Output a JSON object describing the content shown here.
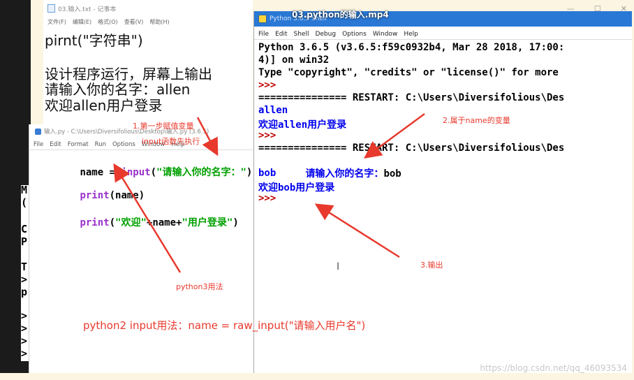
{
  "video_title": "03.python的输入.mp4",
  "notepad": {
    "title": "03.输入.txt - 记事本",
    "menu": [
      "文件(F)",
      "编辑(E)",
      "格式(O)",
      "查看(V)",
      "帮助(H)"
    ],
    "lines": [
      "pirnt(\"字符串\")",
      "",
      "设计程序运行，屏幕上输出",
      "请输入你的名字：allen",
      "欢迎allen用户登录"
    ]
  },
  "editor": {
    "title": "输入.py - C:\\Users\\Diversifolious\\Desktop\\输入.py (3.6.5)",
    "menu": [
      "File",
      "Edit",
      "Format",
      "Run",
      "Options",
      "Window",
      "Help"
    ],
    "code": {
      "l1_a": "name = ",
      "l1_b": "input",
      "l1_c": "(",
      "l1_d": "\"请输入你的名字：\"",
      "l1_e": ")",
      "l2_a": "print",
      "l2_b": "(name)",
      "l3_a": "print",
      "l3_b": "(",
      "l3_c": "\"欢迎\"",
      "l3_d": "+name+",
      "l3_e": "\"用户登录\"",
      "l3_f": ")"
    }
  },
  "shell": {
    "title": "Python 3.6.5 Shell",
    "menu": [
      "File",
      "Edit",
      "Shell",
      "Debug",
      "Options",
      "Window",
      "Help"
    ],
    "lines": {
      "l1": "Python 3.6.5 (v3.6.5:f59c0932b4, Mar 28 2018, 17:00:",
      "l2": "4)] on win32",
      "l3": "Type \"copyright\", \"credits\" or \"license()\" for more",
      "l4": ">>>",
      "l5": "=============== RESTART: C:\\Users\\Diversifolious\\Des",
      "l6": "allen",
      "l7": "欢迎allen用户登录",
      "l8": ">>>",
      "l9": "=============== RESTART: C:\\Users\\Diversifolious\\Des",
      "l10a": "请输入你的名字：",
      "l10b": "bob",
      "l11": "bob",
      "l12": "欢迎bob用户登录",
      "l13": ">>>"
    }
  },
  "annotations": {
    "a1": "1.第一步赋值变量",
    "a1b": "input函数先执行",
    "a2": "2.属于name的变量",
    "a3": "3.输出",
    "a4": "python3用法",
    "a5": "python2 input用法：name = raw_input(\"请输入用户名\")"
  },
  "left_strip": [
    "M",
    "(",
    "C",
    "P",
    "T",
    ">",
    "p",
    ">",
    ">",
    ">",
    ">"
  ],
  "watermark": "https://blog.csdn.net/qq_46093534",
  "colors": {
    "keyword": "#9932cc",
    "string": "#00a000",
    "output": "#0000ee",
    "prompt": "#c00000",
    "annotation": "#e8392d"
  }
}
